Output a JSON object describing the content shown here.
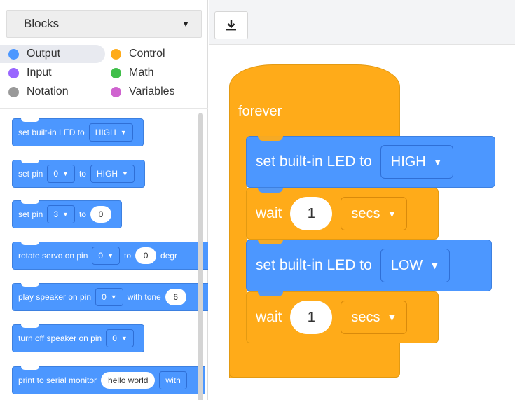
{
  "selector": {
    "value": "Blocks"
  },
  "categories": [
    {
      "label": "Output",
      "color": "#4C97FF",
      "selected": true
    },
    {
      "label": "Control",
      "color": "#FFAB19"
    },
    {
      "label": "Input",
      "color": "#9966FF"
    },
    {
      "label": "Math",
      "color": "#40BF4A"
    },
    {
      "label": "Notation",
      "color": "#999999"
    },
    {
      "label": "Variables",
      "color": "#CF63CF"
    }
  ],
  "palette": {
    "b1": {
      "text": "set built-in LED to",
      "dd": "HIGH"
    },
    "b2": {
      "text1": "set pin",
      "dd1": "0",
      "text2": "to",
      "dd2": "HIGH"
    },
    "b3": {
      "text1": "set pin",
      "dd1": "3",
      "text2": "to",
      "num": "0"
    },
    "b4": {
      "text1": "rotate servo on pin",
      "dd1": "0",
      "text2": "to",
      "num": "0",
      "text3": "degr"
    },
    "b5": {
      "text1": "play speaker on pin",
      "dd1": "0",
      "text2": "with tone",
      "num": "6"
    },
    "b6": {
      "text1": "turn off speaker on pin",
      "dd1": "0"
    },
    "b7": {
      "text1": "print to serial monitor",
      "num": "hello world",
      "text2": "with"
    }
  },
  "workspace": {
    "forever": "forever",
    "blocks": [
      {
        "text": "set built-in LED to",
        "dropdown": "HIGH"
      },
      {
        "text": "wait",
        "number": "1",
        "dropdown": "secs"
      },
      {
        "text": "set built-in LED to",
        "dropdown": "LOW"
      },
      {
        "text": "wait",
        "number": "1",
        "dropdown": "secs"
      }
    ]
  }
}
